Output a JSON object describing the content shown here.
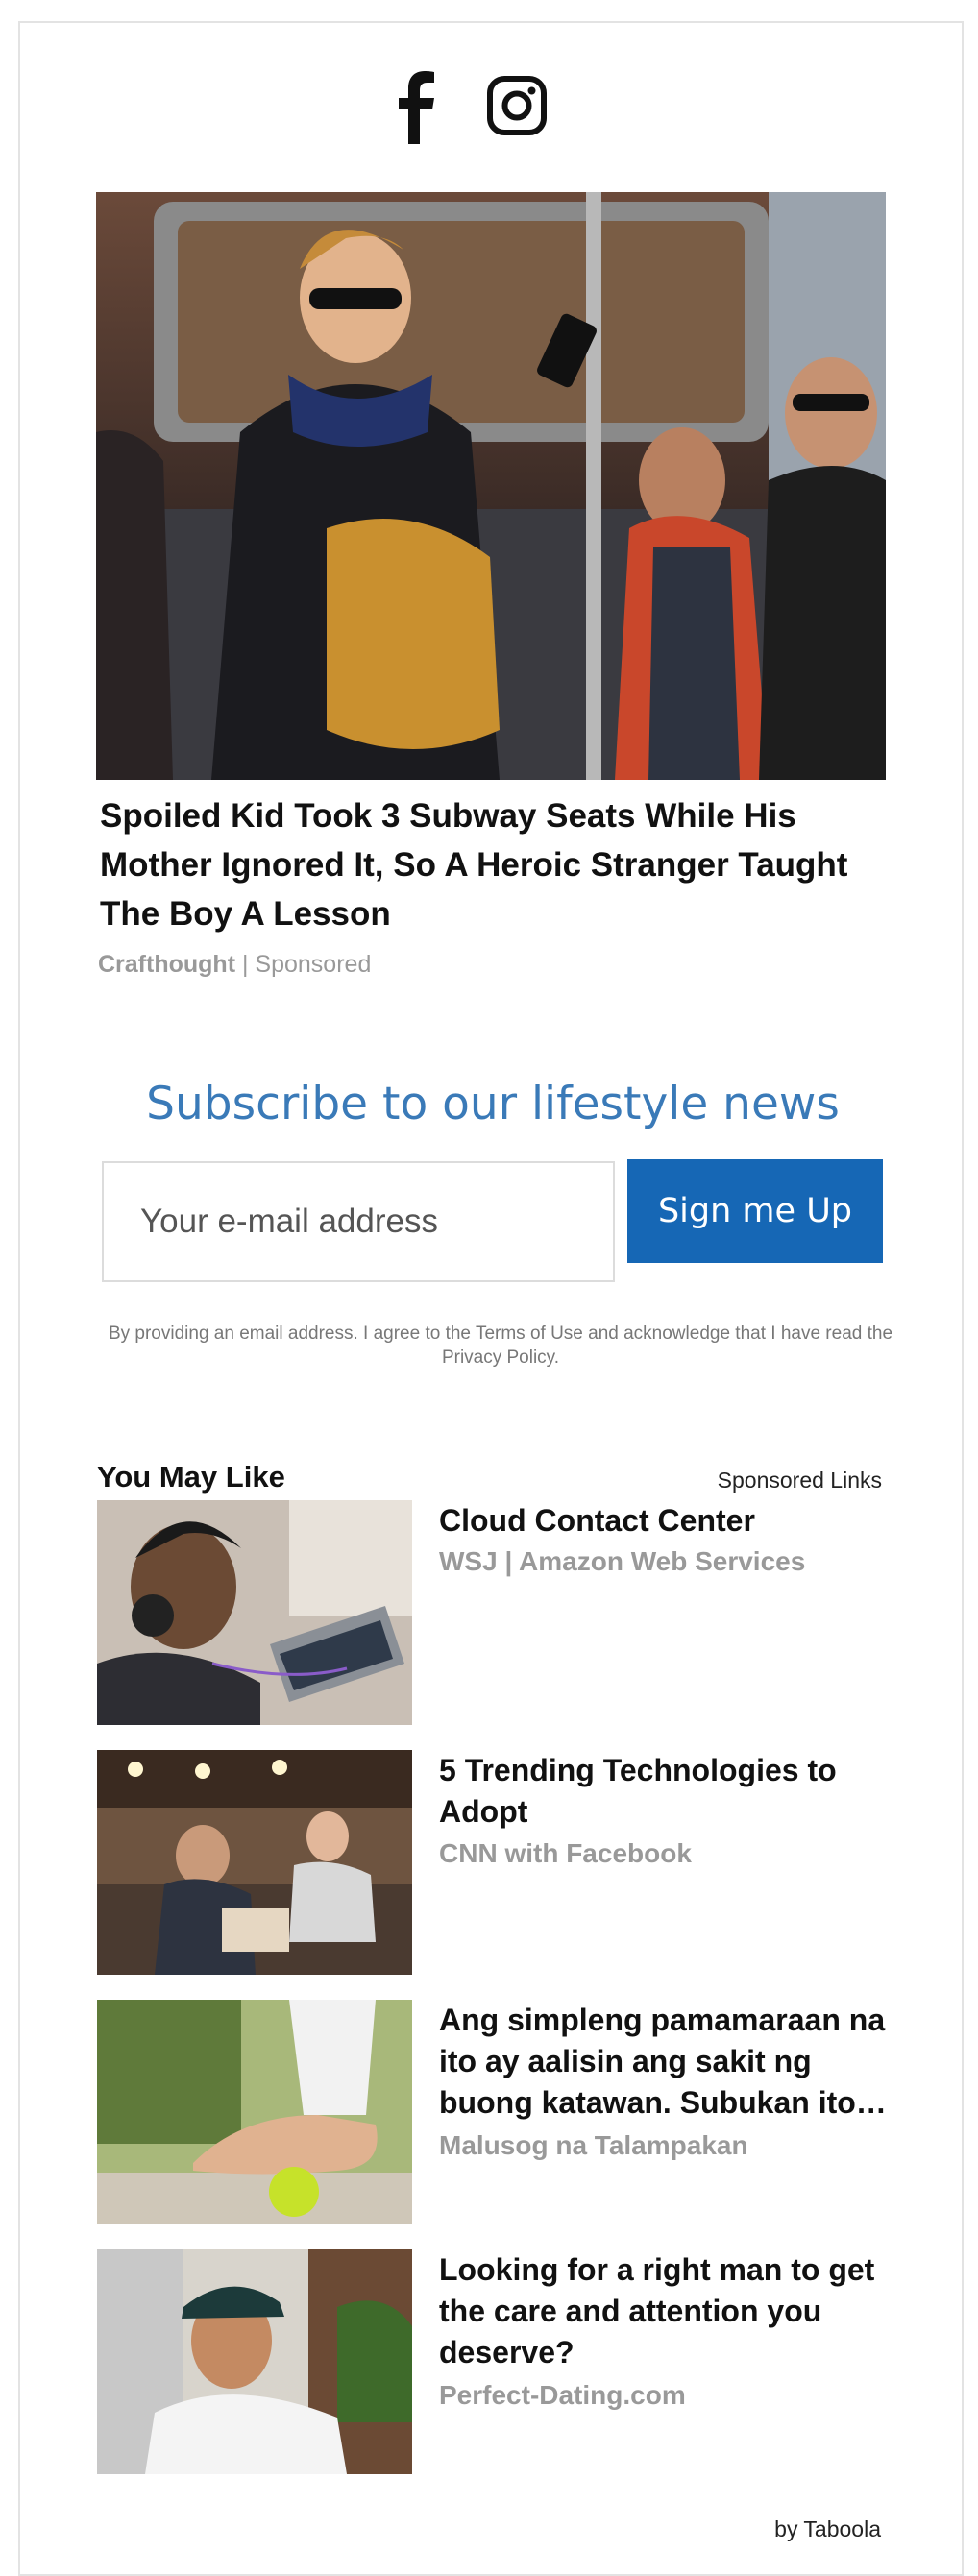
{
  "social": {
    "facebook_icon": "facebook-icon",
    "instagram_icon": "instagram-icon"
  },
  "hero": {
    "title": "Spoiled Kid Took 3 Subway Seats While His Mother Ignored It, So A Heroic Stranger Taught The Boy A Lesson",
    "brand": "Crafthought",
    "separator": " | ",
    "sponsored": "Sponsored"
  },
  "subscribe": {
    "heading": "Subscribe to our lifestyle news",
    "email_placeholder": "Your e-mail address",
    "button_label": "Sign me Up",
    "legal": "By providing an email address. I agree to the Terms of Use and acknowledge that I have read the Privacy Policy."
  },
  "recommendations": {
    "title": "You May Like",
    "sponsored_label": "Sponsored Links",
    "items": [
      {
        "title": "Cloud Contact Center",
        "source": "WSJ | Amazon Web Services"
      },
      {
        "title": "5 Trending Technologies to Adopt",
        "source": "CNN with Facebook"
      },
      {
        "title": "Ang simpleng pamamaraan na ito ay aalisin ang sakit ng buong katawan. Subukan ito…",
        "source": "Malusog na Talampakan"
      },
      {
        "title": "Looking for a right man to get the care and attention you deserve?",
        "source": "Perfect-Dating.com"
      }
    ],
    "footer": "by Taboola"
  }
}
